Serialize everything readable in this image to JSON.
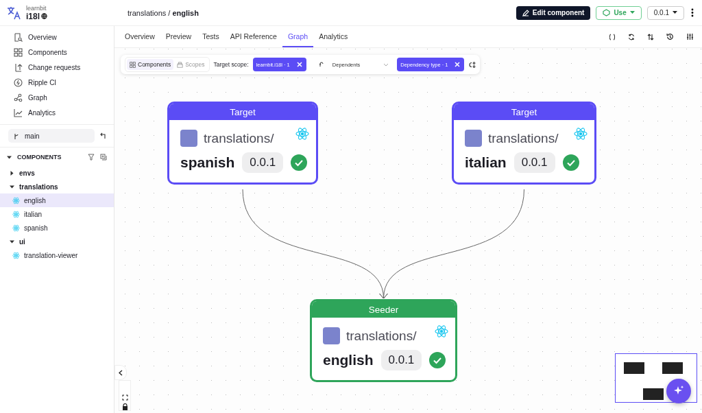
{
  "header": {
    "org": "learnbit",
    "scope": "i18l",
    "breadcrumb": "translations / **english**",
    "edit_button": "Edit component",
    "use_button": "Use",
    "version": "0.0.1"
  },
  "sidebar": {
    "nav": [
      {
        "label": "Overview"
      },
      {
        "label": "Components"
      },
      {
        "label": "Change requests"
      },
      {
        "label": "Ripple CI"
      },
      {
        "label": "Graph"
      },
      {
        "label": "Analytics"
      }
    ],
    "branch": "main",
    "section_title": "COMPONENTS",
    "section_expanded": true,
    "tree": [
      {
        "label": "envs",
        "expanded": false
      },
      {
        "label": "translations",
        "expanded": true,
        "children": [
          {
            "label": "english",
            "selected": true
          },
          {
            "label": "italian",
            "selected": false
          },
          {
            "label": "spanish",
            "selected": false
          }
        ]
      },
      {
        "label": "ui",
        "expanded": true,
        "children": [
          {
            "label": "translation-viewer",
            "selected": false
          }
        ]
      }
    ]
  },
  "tabs": [
    {
      "label": "Overview",
      "selected": false
    },
    {
      "label": "Preview",
      "selected": false
    },
    {
      "label": "Tests",
      "selected": false
    },
    {
      "label": "API Reference",
      "selected": false
    },
    {
      "label": "Graph",
      "selected": true
    },
    {
      "label": "Analytics",
      "selected": false
    }
  ],
  "toolbar": {
    "views": [
      {
        "label": "Components",
        "selected": true
      },
      {
        "label": "Scopes",
        "selected": false
      }
    ],
    "target_label": "Target scope:",
    "scope_chip": "learnbit.i18l · 1",
    "direction": "Dependents",
    "type_chip": "Dependency type · 1"
  },
  "graph": {
    "nodes": [
      {
        "kind": "target",
        "role": "Target",
        "scope": "translations/",
        "name": "spanish",
        "version": "0.0.1",
        "ok": true
      },
      {
        "kind": "target",
        "role": "Target",
        "scope": "translations/",
        "name": "italian",
        "version": "0.0.1",
        "ok": true
      },
      {
        "kind": "seeder",
        "role": "Seeder",
        "scope": "translations/",
        "name": "english",
        "version": "0.0.1",
        "ok": true
      }
    ]
  }
}
